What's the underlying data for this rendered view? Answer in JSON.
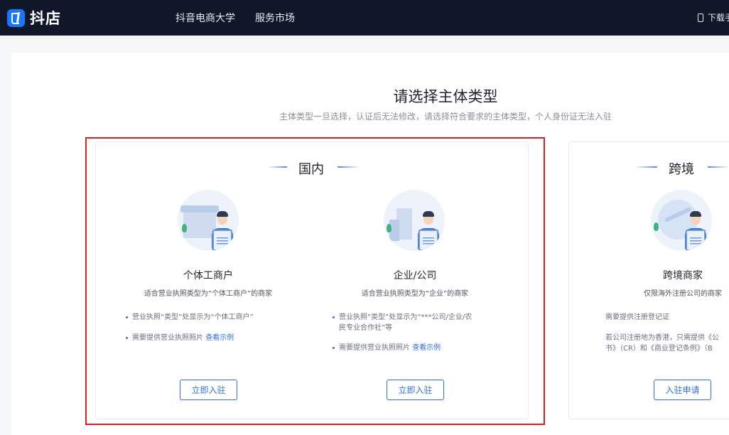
{
  "header": {
    "logo_text": "抖店",
    "nav": [
      "抖音电商大学",
      "服务市场"
    ],
    "download_label": "下载手"
  },
  "page": {
    "title": "请选择主体类型",
    "subtitle": "主体类型一旦选择，认证后无法修改，请选择符合要求的主体类型，个人身份证无法入驻"
  },
  "domestic": {
    "title": "国内",
    "options": [
      {
        "name": "个体工商户",
        "desc": "适合营业执照类型为“个体工商户”的商家",
        "bullets": [
          "营业执照“类型”处显示为“个体工商户”"
        ],
        "photo_req": "需要提供营业执照照片",
        "link": "查看示例",
        "button": "立即入驻"
      },
      {
        "name": "企业/公司",
        "desc": "适合营业执照类型为“企业”的商家",
        "bullets": [
          "营业执照“类型”处显示为“***公司/企业/农",
          "民专业合作社”等"
        ],
        "photo_req": "需要提供营业执照照片",
        "link": "查看示例",
        "button": "立即入驻"
      }
    ]
  },
  "cross_border": {
    "title": "跨境",
    "name": "跨境商家",
    "desc": "仅限海外注册公司的商家",
    "bullets": [
      "需要提供注册登记证",
      "若公司注册地为香港，只需提供《公",
      "书》（CR）和《商业登记条例》（B"
    ],
    "button": "入驻申请"
  },
  "colors": {
    "accent": "#2f6fe6",
    "nav_bg": "#0f1729",
    "highlight": "#e02020"
  }
}
